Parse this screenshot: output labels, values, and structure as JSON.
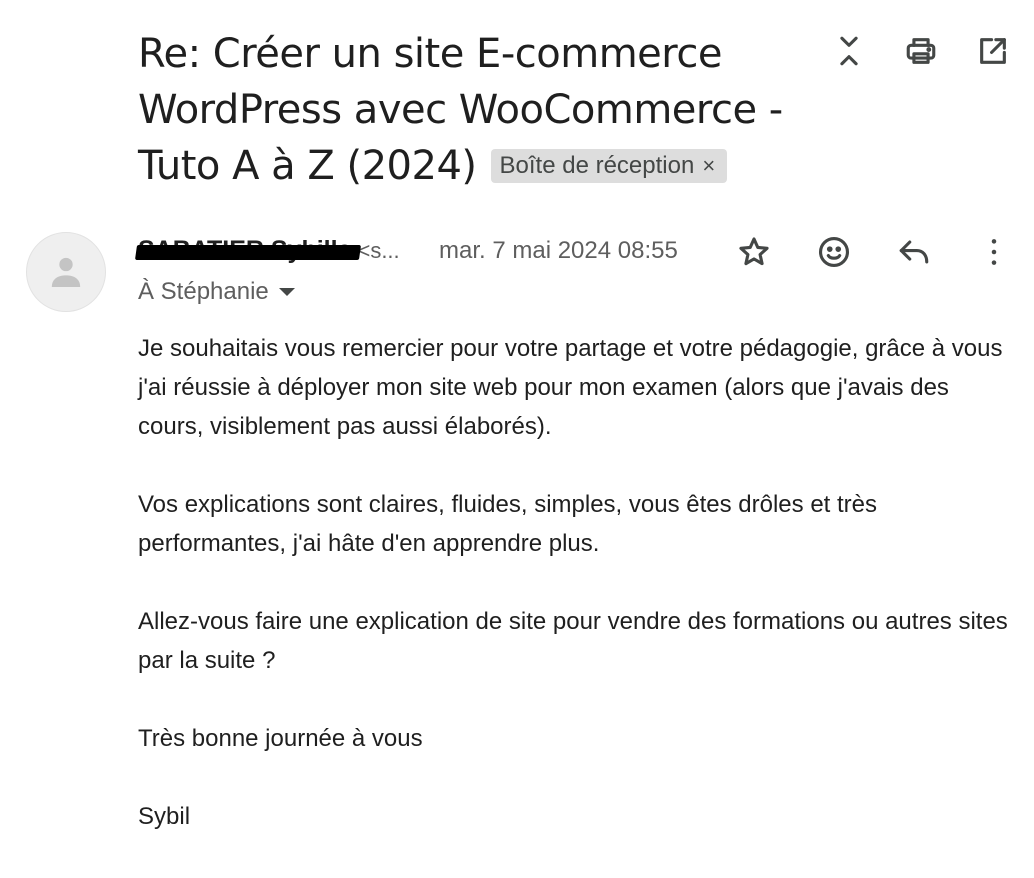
{
  "email": {
    "subject": "Re: Créer un site E-commerce WordPress avec WooCommerce - Tuto A à Z (2024)",
    "label": "Boîte de réception",
    "label_close": "×",
    "sender_name": "SABATIER Sybille",
    "sender_email": "<s...",
    "timestamp": "mar. 7 mai 2024 08:55",
    "recipient": "À Stéphanie",
    "body": [
      "Je souhaitais vous remercier pour votre partage et votre pédagogie, grâce à vous j'ai réussie à déployer mon site web pour mon examen (alors que j'avais des cours, visiblement pas aussi élaborés).",
      "Vos explications sont claires, fluides, simples, vous êtes drôles et très performantes, j'ai hâte d'en apprendre plus.",
      "Allez-vous faire une explication de site pour vendre des formations ou autres sites par la suite ?",
      "Très bonne journée à vous",
      "Sybil"
    ]
  },
  "icons": {
    "top_actions": [
      "collapse-all-icon",
      "print-icon",
      "open-in-new-window-icon"
    ],
    "message_actions": [
      "star-icon",
      "emoji-reaction-icon",
      "reply-icon",
      "more-vert-icon"
    ]
  },
  "colors": {
    "text": "#1f1f1f",
    "secondary_text": "#5e5e5e",
    "label_chip_bg": "#dddddd",
    "icon": "#444746"
  }
}
